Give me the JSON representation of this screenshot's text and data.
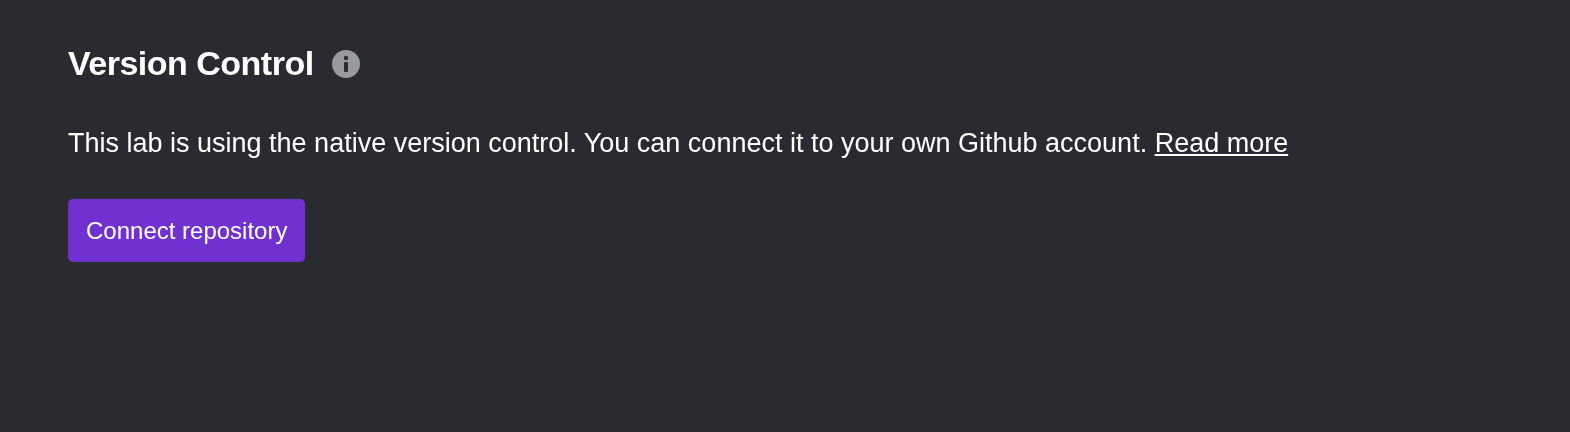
{
  "section": {
    "title": "Version Control",
    "description": "This lab is using the native version control. You can connect it to your own Github account.",
    "link": "Read more"
  },
  "button": {
    "label": "Connect repository"
  }
}
